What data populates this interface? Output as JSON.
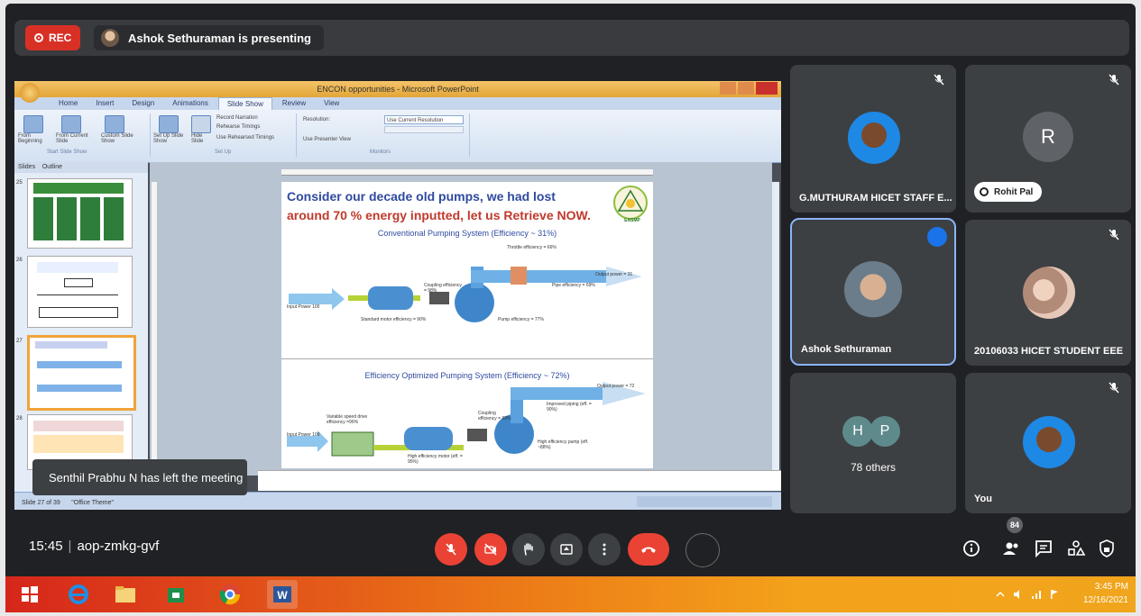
{
  "meet": {
    "rec_label": "REC",
    "presenter_banner": "Ashok Sethuraman is presenting",
    "toast": "Senthil Prabhu N has left the meeting",
    "time": "15:45",
    "meeting_code": "aop-zmkg-gvf",
    "participants_badge": "84"
  },
  "participants": [
    {
      "name": "G.MUTHURAM HICET STAFF E...",
      "muted": true
    },
    {
      "name": "Rohit Pal",
      "letter": "R",
      "muted": true
    },
    {
      "name": "Ashok Sethuraman",
      "speaking": true
    },
    {
      "name": "20106033 HICET STUDENT EEE",
      "muted": true
    },
    {
      "name": "78 others",
      "letters": [
        "H",
        "P"
      ]
    },
    {
      "name": "You",
      "muted": true
    }
  ],
  "ppt": {
    "window_title": "ENCON opportunities - Microsoft PowerPoint",
    "tabs": [
      "Home",
      "Insert",
      "Design",
      "Animations",
      "Slide Show",
      "Review",
      "View"
    ],
    "active_tab": "Slide Show",
    "ribbon": {
      "from_beginning": "From Beginning",
      "from_current": "From Current Slide",
      "custom_show": "Custom Slide Show",
      "setup_show": "Set Up Slide Show",
      "hide_slide": "Hide Slide",
      "record_narration": "Record Narration",
      "rehearse": "Rehearse Timings",
      "use_timings": "Use Rehearsed Timings",
      "resolution": "Resolution:",
      "resolution_value": "Use Current Resolution",
      "presenter_view": "Use Presenter View",
      "group_start": "Start Slide Show",
      "group_setup": "Set Up",
      "group_monitors": "Monitors"
    },
    "pane_tabs": [
      "Slides",
      "Outline"
    ],
    "thumb_numbers": [
      "25",
      "26",
      "27",
      "28"
    ],
    "status": "Slide 27 of 39",
    "theme": "\"Office Theme\""
  },
  "slide": {
    "title_line1": "Consider our decade old pumps, we had lost",
    "title_line2": "around 70 % energy inputted, let us Retrieve NOW.",
    "logo_text": "EASMP",
    "conventional_heading": "Conventional Pumping System (Efficiency ~ 31%)",
    "optimized_heading": "Efficiency Optimized Pumping System (Efficiency ~ 72%)",
    "labels_top": {
      "input_power": "Input Power 100",
      "standard_motor": "Standard motor efficiency = 90%",
      "coupling": "Coupling efficiency = 98%",
      "pump": "Pump efficiency = 77%",
      "throttle": "Throttle efficiency = 66%",
      "pipe": "Pipe efficiency = 69%",
      "output": "Output power = 31"
    },
    "labels_bottom": {
      "vsd": "Variable speed drive efficiency =96%",
      "input_power": "Input Power 100",
      "high_eff_motor": "High efficiency motor (eff. = 95%)",
      "coupling": "Coupling efficiency = 99%",
      "high_eff_pump": "High efficiency pump (eff. ~88%)",
      "improved_piping": "Improved piping (eff. = 90%)",
      "output": "Output power = 72"
    }
  },
  "taskbar": {
    "time": "3:45 PM",
    "date": "12/16/2021"
  },
  "colors": {
    "meet_bg": "#202124",
    "tile_bg": "#3c4043",
    "red": "#ea4335",
    "accent_blue": "#8ab4f8"
  }
}
